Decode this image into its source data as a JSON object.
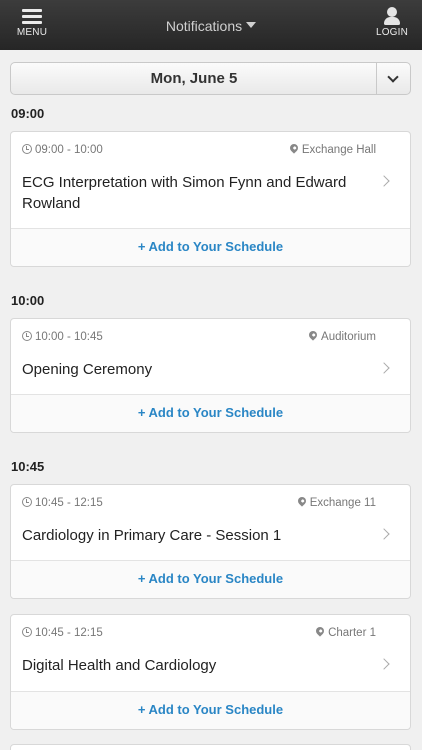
{
  "header": {
    "menu_label": "MENU",
    "title": "Notifications",
    "login_label": "LOGIN"
  },
  "date_selector": {
    "label": "Mon, June 5"
  },
  "add_label": "Add to Your Schedule",
  "add_icon": "plus-icon",
  "groups": [
    {
      "time": "09:00",
      "sessions": [
        {
          "time": "09:00 - 10:00",
          "location": "Exchange Hall",
          "title": "ECG Interpretation with Simon Fynn and Edward Rowland"
        }
      ]
    },
    {
      "time": "10:00",
      "sessions": [
        {
          "time": "10:00 - 10:45",
          "location": "Auditorium",
          "title": "Opening Ceremony"
        }
      ]
    },
    {
      "time": "10:45",
      "sessions": [
        {
          "time": "10:45 - 12:15",
          "location": "Exchange 11",
          "title": "Cardiology in Primary Care - Session 1"
        },
        {
          "time": "10:45 - 12:15",
          "location": "Charter 1",
          "title": "Digital Health and Cardiology"
        }
      ]
    }
  ],
  "colors": {
    "header_bg": "#2e2e2e",
    "accent": "#2a86c5",
    "page_bg": "#f0f0f0"
  }
}
